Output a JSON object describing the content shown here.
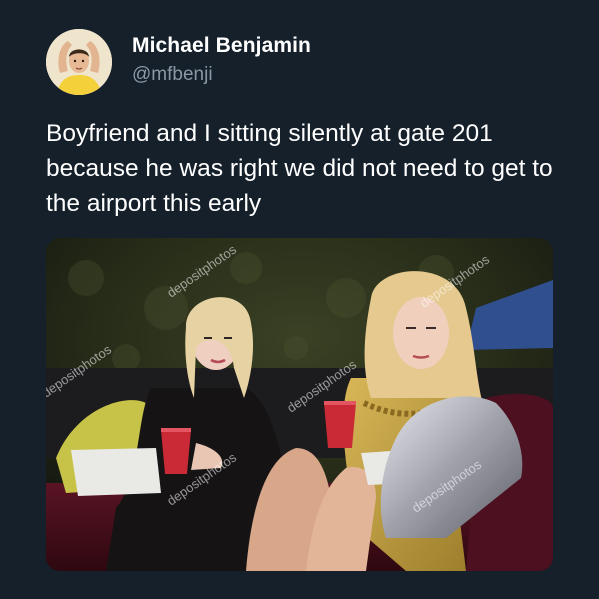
{
  "author": {
    "display_name": "Michael Benjamin",
    "handle": "@mfbenji",
    "avatar_icon": "profile-photo"
  },
  "tweet": {
    "text": "Boyfriend and I sitting silently at gate 201 because he was right we did not need to get to the airport this early"
  },
  "media": {
    "watermark": "depositphotos"
  },
  "colors": {
    "background": "#15202b",
    "handle": "#8b98a5",
    "text": "#ffffff"
  }
}
